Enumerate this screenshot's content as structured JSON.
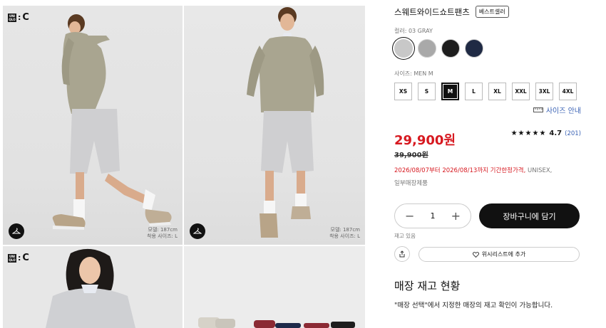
{
  "gallery": {
    "brand_logo_box": "UNI QLO",
    "brand_logo_suffix": "C",
    "tiles": [
      {
        "model_height": "모델: 187cm",
        "wear_size": "착용 사이즈: L"
      },
      {
        "model_height": "모델: 187cm",
        "wear_size": "착용 사이즈: L"
      }
    ]
  },
  "product": {
    "title": "스웨트와이드쇼트팬츠",
    "badge": "베스트셀러",
    "color_label": "컬러: 03 GRAY",
    "colors": [
      {
        "name": "GRAY",
        "hex": "#c8c8c8",
        "selected": true
      },
      {
        "name": "GRAY-HEATHER",
        "hex": "#a9a9a9",
        "selected": false
      },
      {
        "name": "BLACK",
        "hex": "#1e1e1e",
        "selected": false
      },
      {
        "name": "NAVY",
        "hex": "#1f2a44",
        "selected": false
      }
    ],
    "size_label": "사이즈: MEN M",
    "sizes": [
      "XS",
      "S",
      "M",
      "L",
      "XL",
      "XXL",
      "3XL",
      "4XL"
    ],
    "selected_size": "M",
    "size_guide": "사이즈 안내",
    "price": "29,900원",
    "original_price": "39,900원",
    "rating": {
      "stars": "★★★★★",
      "value": "4.7",
      "count": "(201)"
    },
    "promo": "2026/08/07부터 2026/08/13까지 기간한정가격,",
    "promo_tag": "UNISEX,",
    "store_only": "일부매장제품",
    "quantity": "1",
    "minus": "−",
    "plus": "+",
    "cart_label": "장바구니에 담기",
    "stock": "재고 있음",
    "wishlist_label": "위시리스트에 추가",
    "section_title": "매장 재고 현황",
    "section_desc": "\"매장 선택\"에서 지정한 매장의 재고 확인이 가능합니다."
  },
  "colors": {
    "accent_red": "#d71920",
    "link_blue": "#3b63b5",
    "black": "#111111"
  }
}
